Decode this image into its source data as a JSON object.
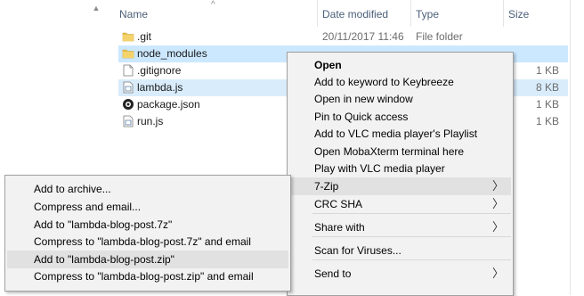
{
  "columns": {
    "name": "Name",
    "date": "Date modified",
    "type": "Type",
    "size": "Size"
  },
  "files": [
    {
      "name": ".git",
      "date": "20/11/2017 11:46",
      "type": "File folder",
      "size": "",
      "icon": "folder-icon",
      "state": ""
    },
    {
      "name": "node_modules",
      "date": "",
      "type": "",
      "size": "",
      "icon": "folder-icon",
      "state": "selected"
    },
    {
      "name": ".gitignore",
      "date": "",
      "type": "",
      "size": "1 KB",
      "icon": "file-icon",
      "state": ""
    },
    {
      "name": "lambda.js",
      "date": "",
      "type": "",
      "size": "8 KB",
      "icon": "js-file-icon",
      "state": "selected"
    },
    {
      "name": "package.json",
      "date": "",
      "type": "",
      "size": "1 KB",
      "icon": "json-file-icon",
      "state": ""
    },
    {
      "name": "run.js",
      "date": "",
      "type": "",
      "size": "1 KB",
      "icon": "js-file-icon",
      "state": ""
    }
  ],
  "context_menu": {
    "items": [
      {
        "label": "Open",
        "bold": true
      },
      {
        "label": "Add to keyword to Keybreeze"
      },
      {
        "label": "Open in new window"
      },
      {
        "label": "Pin to Quick access"
      },
      {
        "label": "Add to VLC media player's Playlist"
      },
      {
        "label": "Open MobaXterm terminal here"
      },
      {
        "label": "Play with VLC media player"
      },
      {
        "label": "7-Zip",
        "submenu": true,
        "highlighted": true
      },
      {
        "label": "CRC SHA",
        "submenu": true
      },
      {
        "label": "Share with",
        "submenu": true
      },
      {
        "label": "Scan for Viruses..."
      },
      {
        "label": "Send to",
        "submenu": true
      }
    ]
  },
  "submenu_7zip": {
    "items": [
      {
        "label": "Add to archive..."
      },
      {
        "label": "Compress and email..."
      },
      {
        "label": "Add to \"lambda-blog-post.7z\""
      },
      {
        "label": "Compress to \"lambda-blog-post.7z\" and email"
      },
      {
        "label": "Add to \"lambda-blog-post.zip\"",
        "highlighted": true
      },
      {
        "label": "Compress to \"lambda-blog-post.zip\" and email"
      }
    ]
  },
  "colors": {
    "selection": "#cce8ff",
    "menu_bg": "#f2f2f2",
    "menu_highlight": "#e1e1e1",
    "folder": "#e8c14a"
  }
}
